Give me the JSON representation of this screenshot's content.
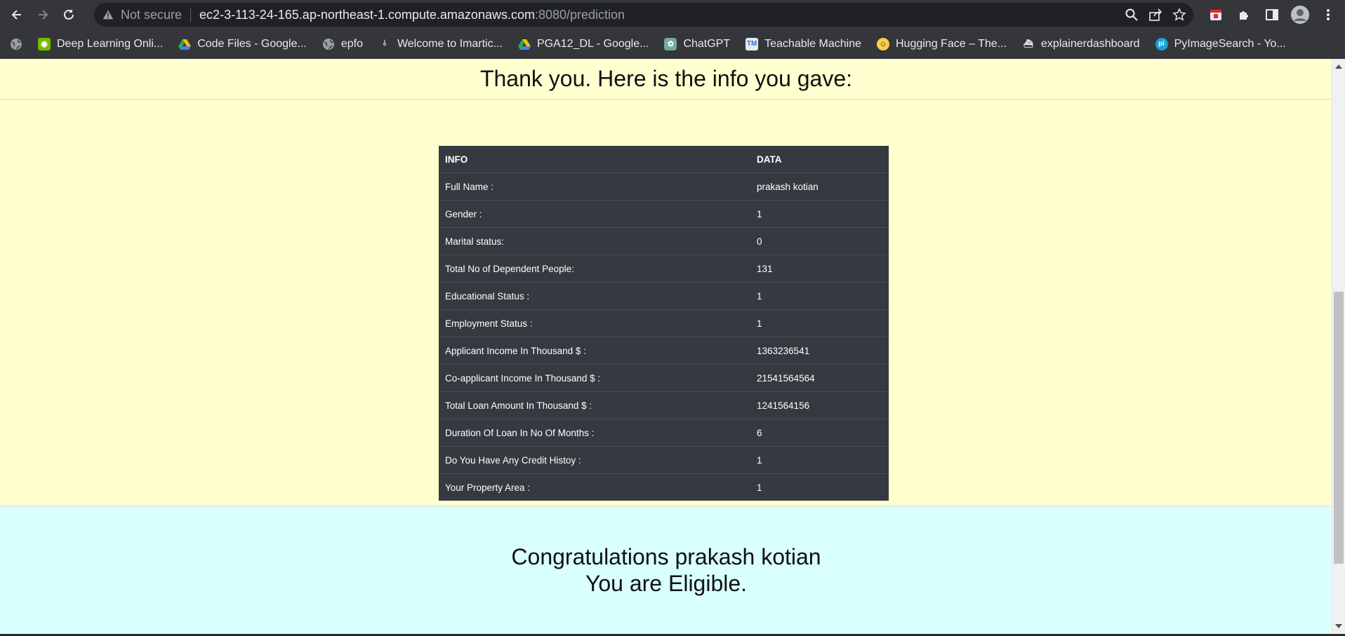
{
  "browser": {
    "security_label": "Not secure",
    "url_host": "ec2-3-113-24-165.ap-northeast-1.compute.amazonaws.com",
    "url_rest": ":8080/prediction",
    "bookmarks": [
      {
        "label": "",
        "icon": "globe-icon"
      },
      {
        "label": "Deep Learning Onli...",
        "icon": "nvidia-icon"
      },
      {
        "label": "Code Files - Google...",
        "icon": "drive-icon"
      },
      {
        "label": "epfo",
        "icon": "globe-icon"
      },
      {
        "label": "Welcome to Imartic...",
        "icon": "imarticus-icon"
      },
      {
        "label": "PGA12_DL - Google...",
        "icon": "drive-icon"
      },
      {
        "label": "ChatGPT",
        "icon": "chatgpt-icon"
      },
      {
        "label": "Teachable Machine",
        "icon": "teachable-machine-icon"
      },
      {
        "label": "Hugging Face – The...",
        "icon": "hugging-face-icon"
      },
      {
        "label": "explainerdashboard",
        "icon": "explainerdashboard-icon"
      },
      {
        "label": "PyImageSearch - Yo...",
        "icon": "pyimagesearch-icon"
      }
    ]
  },
  "page": {
    "thanks_heading": "Thank you. Here is the info you gave:",
    "table": {
      "headers": [
        "INFO",
        "DATA"
      ],
      "rows": [
        [
          "Full Name :",
          "prakash kotian"
        ],
        [
          "Gender :",
          "1"
        ],
        [
          "Marital status:",
          "0"
        ],
        [
          "Total No of Dependent People:",
          "131"
        ],
        [
          "Educational Status :",
          "1"
        ],
        [
          "Employment Status :",
          "1"
        ],
        [
          "Applicant Income In Thousand $ :",
          "1363236541"
        ],
        [
          "Co-applicant Income In Thousand $ :",
          "21541564564"
        ],
        [
          "Total Loan Amount In Thousand $ :",
          "1241564156"
        ],
        [
          "Duration Of Loan In No Of Months :",
          "6"
        ],
        [
          "Do You Have Any Credit Histoy :",
          "1"
        ],
        [
          "Your Property Area :",
          "1"
        ]
      ]
    },
    "result_line1": "Congratulations prakash kotian",
    "result_line2": "You are Eligible."
  }
}
